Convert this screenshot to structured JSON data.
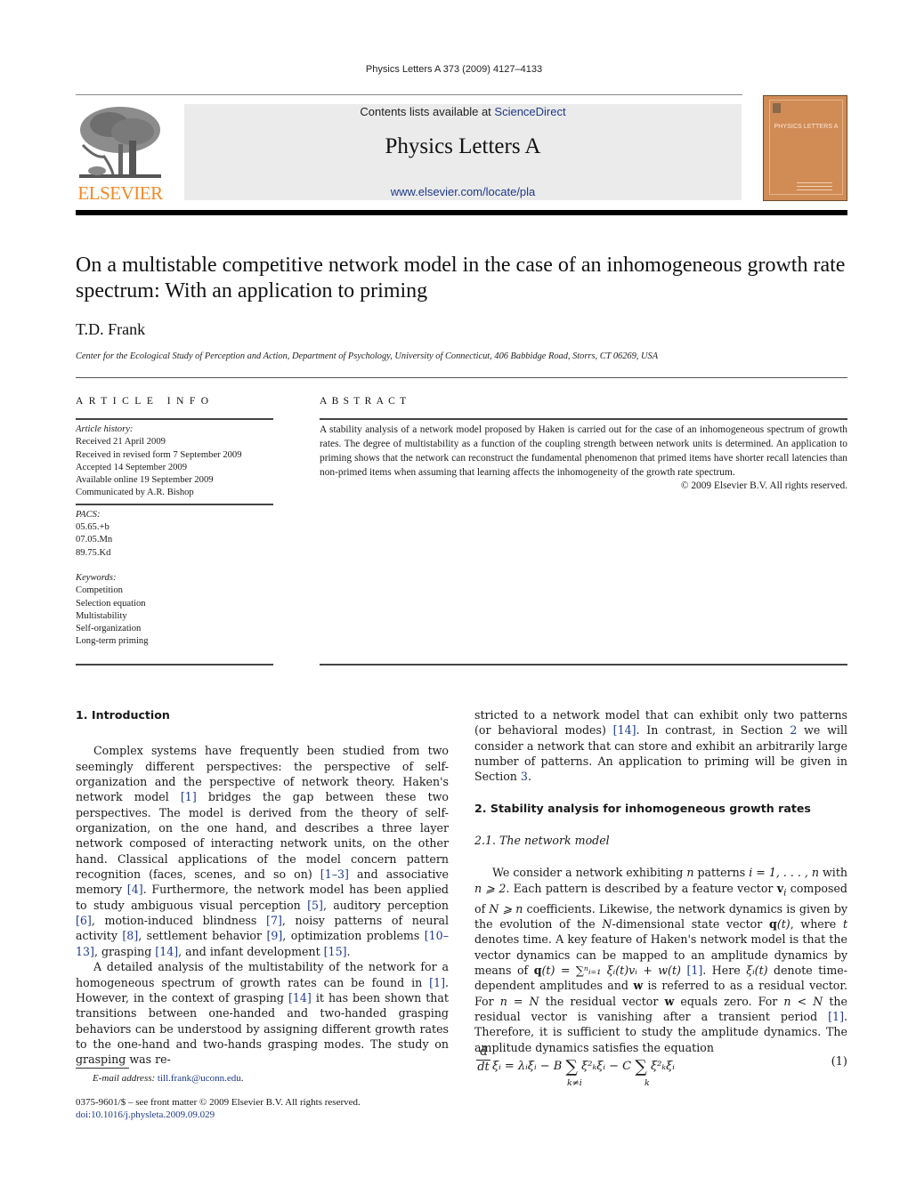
{
  "running_head": "Physics Letters A 373 (2009) 4127–4133",
  "masthead": {
    "publisher_logo": "ELSEVIER",
    "contents_prefix": "Contents lists available at ",
    "contents_link": "ScienceDirect",
    "journal_name": "Physics Letters A",
    "journal_url": "www.elsevier.com/locate/pla",
    "cover_title": "PHYSICS LETTERS A",
    "publisher_color": "#f08a24",
    "cover_color": "#d18b55",
    "link_color": "#1f3a8a"
  },
  "article": {
    "title": "On a multistable competitive network model in the case of an inhomogeneous growth rate spectrum: With an application to priming",
    "author": "T.D. Frank",
    "affiliation": "Center for the Ecological Study of Perception and Action, Department of Psychology, University of Connecticut, 406 Babbidge Road, Storrs, CT 06269, USA"
  },
  "article_info": {
    "heading": "ARTICLE INFO",
    "history_label": "Article history:",
    "history": [
      "Received 21 April 2009",
      "Received in revised form 7 September 2009",
      "Accepted 14 September 2009",
      "Available online 19 September 2009",
      "Communicated by A.R. Bishop"
    ],
    "pacs_label": "PACS:",
    "pacs": [
      "05.65.+b",
      "07.05.Mn",
      "89.75.Kd"
    ],
    "keywords_label": "Keywords:",
    "keywords": [
      "Competition",
      "Selection equation",
      "Multistability",
      "Self-organization",
      "Long-term priming"
    ]
  },
  "abstract": {
    "heading": "ABSTRACT",
    "text": "A stability analysis of a network model proposed by Haken is carried out for the case of an inhomogeneous spectrum of growth rates. The degree of multistability as a function of the coupling strength between network units is determined. An application to priming shows that the network can reconstruct the fundamental phenomenon that primed items have shorter recall latencies than non-primed items when assuming that learning affects the inhomogeneity of the growth rate spectrum.",
    "copyright": "© 2009 Elsevier B.V. All rights reserved."
  },
  "body": {
    "sec1_heading": "1.  Introduction",
    "p1": [
      "Complex systems have frequently been studied from two seemingly different perspectives: the perspective of self-organization and the perspective of network theory. Haken's network model ",
      "[1]",
      " bridges the gap between these two perspectives. The model is derived from the theory of self-organization, on the one hand, and describes a three layer network composed of interacting network units, on the other hand. Classical applications of the model concern pattern recognition (faces, scenes, and so on) ",
      "[1–3]",
      " and associative memory ",
      "[4]",
      ". Furthermore, the network model has been applied to study ambiguous visual perception ",
      "[5]",
      ", auditory perception ",
      "[6]",
      ", motion-induced blindness ",
      "[7]",
      ", noisy patterns of neural activity ",
      "[8]",
      ", settlement behavior ",
      "[9]",
      ", optimization problems ",
      "[10–13]",
      ", grasping ",
      "[14]",
      ", and infant development ",
      "[15]",
      "."
    ],
    "p2": [
      "A detailed analysis of the multistability of the network for a homogeneous spectrum of growth rates can be found in ",
      "[1]",
      ". However, in the context of grasping ",
      "[14]",
      " it has been shown that transitions between one-handed and two-handed grasping behaviors can be understood by assigning different growth rates to the one-hand and two-hands grasping modes. The study on grasping was restricted to a network model that can exhibit only two patterns (or behavioral modes) ",
      "[14]",
      ". In contrast, in Section ",
      "2",
      " we will consider a network that can store and exhibit an arbitrarily large number of patterns. An application to priming will be given in Section ",
      "3",
      "."
    ],
    "sec2_heading": "2.  Stability analysis for inhomogeneous growth rates",
    "sec21_heading": "2.1.  The network model",
    "p3": {
      "a": "We consider a network exhibiting ",
      "n1": "n",
      "b": " patterns ",
      "range": "i = 1, . . . , n",
      "c": " with ",
      "cond1": "n ⩾ 2",
      "d": ". Each pattern is described by a feature vector ",
      "vi": "v",
      "vi_sub": "i",
      "e": " composed of ",
      "cond2": "N ⩾ n",
      "f": " coefficients. Likewise, the network dynamics is given by the evolution of the ",
      "N": "N",
      "g": "-dimensional state vector ",
      "q": "q",
      "qt": "(t)",
      "h": ", where ",
      "t": "t",
      "i": " denotes time. A key feature of Haken's network model is that the vector dynamics can be mapped to an amplitude dynamics by means of ",
      "formula": "(t) = ∑ⁿᵢ₌₁ ξᵢ(t)vᵢ + w(t)",
      "ref1": "[1]",
      "j": ". Here ",
      "xi": "ξᵢ(t)",
      "k": " denote time-dependent amplitudes and ",
      "w1": "w",
      "l": " is referred to as a residual vector. For ",
      "nN": "n = N",
      "m": " the residual vector ",
      "w2": "w",
      "o": " equals zero. For ",
      "nlN": "n < N",
      "p": " the residual vector is vanishing after a transient period ",
      "ref2": "[1]",
      "r": ". Therefore, it is sufficient to study the amplitude dynamics. The amplitude dynamics satisfies the equation"
    },
    "equation": {
      "num_d": "d",
      "den_dt": "dt",
      "lhs": "ξᵢ = λᵢξᵢ − B",
      "sum": "∑",
      "term1": "ξ²ₖξᵢ − C",
      "term2": "ξ²ₖξᵢ",
      "under1": "k≠i",
      "under2": "k",
      "number": "(1)"
    }
  },
  "footnote": {
    "email_label": "E-mail address:",
    "email": "till.frank@uconn.edu",
    "front_matter": "0375-9601/$ – see front matter  © 2009 Elsevier B.V. All rights reserved.",
    "doi": "doi:10.1016/j.physleta.2009.09.029"
  }
}
